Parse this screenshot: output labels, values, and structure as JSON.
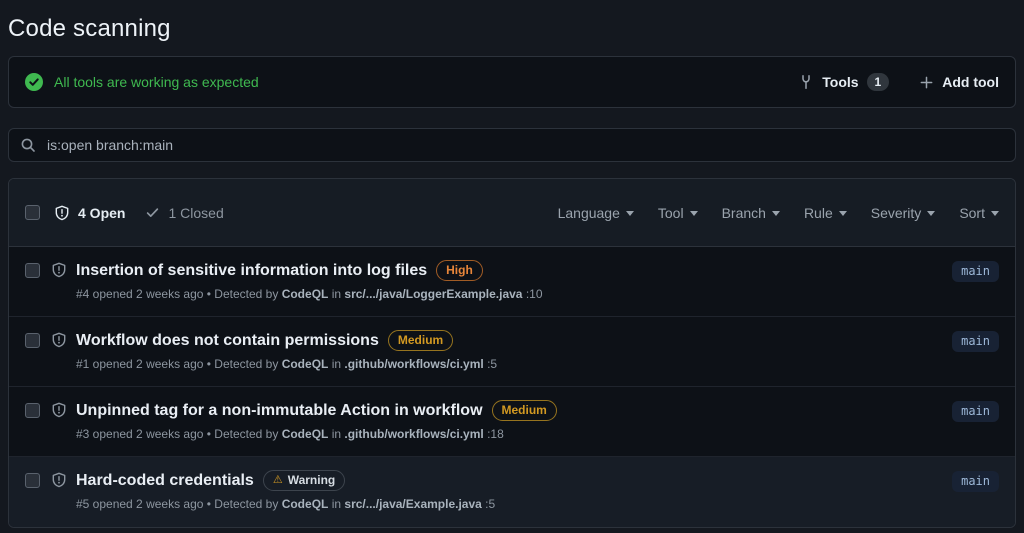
{
  "page": {
    "title": "Code scanning"
  },
  "banner": {
    "message": "All tools are working as expected",
    "tools_label": "Tools",
    "tools_count": "1",
    "add_tool_label": "Add tool"
  },
  "search": {
    "query": "is:open branch:main"
  },
  "list": {
    "header": {
      "open_label": "4 Open",
      "closed_label": "1 Closed",
      "filters": [
        "Language",
        "Tool",
        "Branch",
        "Rule",
        "Severity",
        "Sort"
      ]
    },
    "rows": [
      {
        "title": "Insertion of sensitive information into log files",
        "severity_label": "High",
        "severity_level": "high",
        "opened": "#4 opened 2 weeks ago • Detected by",
        "tool": "CodeQL",
        "in_word": "in",
        "path": "src/.../java/LoggerExample.java",
        "line": ":10",
        "branch": "main"
      },
      {
        "title": "Workflow does not contain permissions",
        "severity_label": "Medium",
        "severity_level": "medium",
        "opened": "#1 opened 2 weeks ago • Detected by",
        "tool": "CodeQL",
        "in_word": "in",
        "path": ".github/workflows/ci.yml",
        "line": ":5",
        "branch": "main"
      },
      {
        "title": "Unpinned tag for a non-immutable Action in workflow",
        "severity_label": "Medium",
        "severity_level": "medium",
        "opened": "#3 opened 2 weeks ago • Detected by",
        "tool": "CodeQL",
        "in_word": "in",
        "path": ".github/workflows/ci.yml",
        "line": ":18",
        "branch": "main"
      },
      {
        "title": "Hard-coded credentials",
        "severity_label": "Warning",
        "severity_level": "warning",
        "severity_icon": "⚠",
        "opened": "#5 opened 2 weeks ago • Detected by",
        "tool": "CodeQL",
        "in_word": "in",
        "path": "src/.../java/Example.java",
        "line": ":5",
        "branch": "main"
      }
    ]
  },
  "colors": {
    "success_green": "#3fb950",
    "severity_high": "#e8863a",
    "severity_medium": "#d29922",
    "branch_badge_text": "#9db8d8",
    "panel_bg": "#0d1117",
    "border": "#2c323b"
  }
}
